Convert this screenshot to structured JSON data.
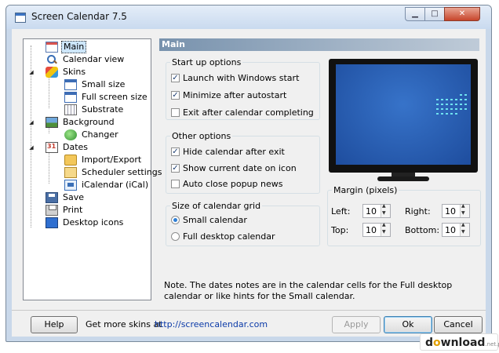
{
  "window": {
    "title": "Screen Calendar 7.5"
  },
  "tree": [
    {
      "label": "Main",
      "icon": "calendar-icon"
    },
    {
      "label": "Calendar view",
      "icon": "magnifier-icon"
    },
    {
      "label": "Skins",
      "icon": "paint-icon"
    },
    {
      "label": "Small size",
      "icon": "window-icon"
    },
    {
      "label": "Full screen size",
      "icon": "window-icon"
    },
    {
      "label": "Substrate",
      "icon": "grid-icon"
    },
    {
      "label": "Background",
      "icon": "picture-icon"
    },
    {
      "label": "Changer",
      "icon": "globe-icon"
    },
    {
      "label": "Dates",
      "icon": "dates-icon"
    },
    {
      "label": "Import/Export",
      "icon": "folder-icon"
    },
    {
      "label": "Scheduler settings",
      "icon": "scheduler-icon"
    },
    {
      "label": "iCalendar (iCal)",
      "icon": "ical-icon"
    },
    {
      "label": "Save",
      "icon": "save-icon"
    },
    {
      "label": "Print",
      "icon": "printer-icon"
    },
    {
      "label": "Desktop icons",
      "icon": "desktop-icon"
    }
  ],
  "main": {
    "header": "Main",
    "startup": {
      "title": "Start up options",
      "options": [
        {
          "label": "Launch with Windows start",
          "checked": true
        },
        {
          "label": "Minimize after autostart",
          "checked": true
        },
        {
          "label": "Exit after calendar completing",
          "checked": false
        }
      ]
    },
    "other": {
      "title": "Other options",
      "options": [
        {
          "label": "Hide calendar after exit",
          "checked": true
        },
        {
          "label": "Show current date on icon",
          "checked": true
        },
        {
          "label": "Auto close popup news",
          "checked": false
        }
      ]
    },
    "grid_size": {
      "title": "Size of calendar grid",
      "options": [
        {
          "label": "Small calendar",
          "selected": true
        },
        {
          "label": "Full desktop calendar",
          "selected": false
        }
      ]
    },
    "margin": {
      "title": "Margin (pixels)",
      "left_label": "Left:",
      "left": "10",
      "right_label": "Right:",
      "right": "10",
      "top_label": "Top:",
      "top": "10",
      "bottom_label": "Bottom:",
      "bottom": "10"
    },
    "note": "Note. The dates notes are in the calendar cells for the Full desktop calendar or like hints for the Small calendar."
  },
  "footer": {
    "help": "Help",
    "more_skins": "Get more skins at",
    "link": "http://screencalendar.com",
    "apply": "Apply",
    "ok": "Ok",
    "cancel": "Cancel"
  },
  "watermark": {
    "text_a": "d",
    "text_o": "o",
    "text_b": "wnload",
    "suffix": ".net.pl"
  },
  "colors": {
    "accent": "#3c7fb1",
    "header_bar": "#7892ad",
    "screen_blue": "#2a5fb8"
  }
}
